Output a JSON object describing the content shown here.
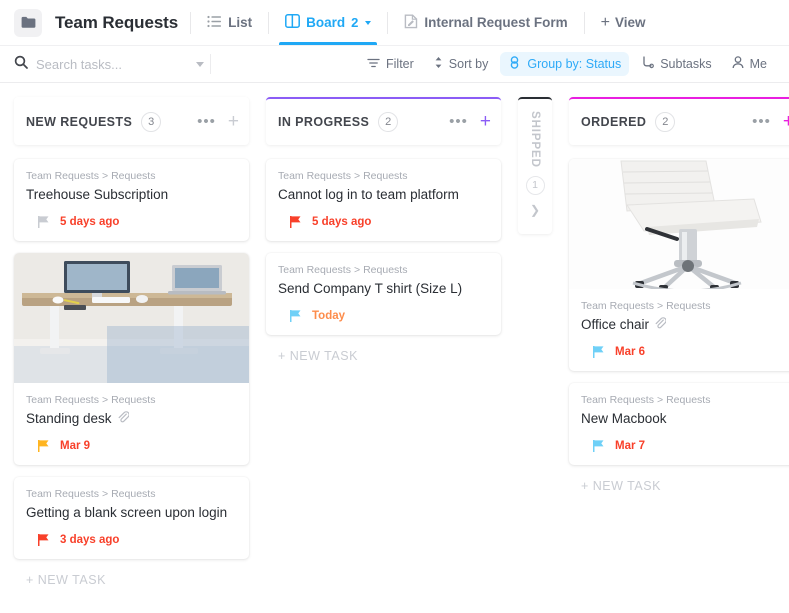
{
  "header": {
    "folder_icon": "folder-icon",
    "title": "Team Requests",
    "tabs": [
      {
        "icon": "list-icon",
        "label": "List",
        "count": "",
        "active": false
      },
      {
        "icon": "board-icon",
        "label": "Board",
        "count": "2",
        "active": true
      },
      {
        "icon": "form-icon",
        "label": "Internal Request Form",
        "count": "",
        "active": false
      }
    ],
    "add_view_label": "View",
    "add_view_plus": "+"
  },
  "toolbar": {
    "search_placeholder": "Search tasks...",
    "search_value": "",
    "search_icon": "search-icon",
    "dropdown_icon": "chevron-down-icon",
    "items": [
      {
        "icon": "filter-icon",
        "label": "Filter",
        "active": false
      },
      {
        "icon": "sort-icon",
        "label": "Sort by",
        "active": false
      },
      {
        "icon": "group-icon",
        "label": "Group by: Status",
        "active": true
      },
      {
        "icon": "subtasks-icon",
        "label": "Subtasks",
        "active": false
      },
      {
        "icon": "person-icon",
        "label": "Me",
        "active": false
      }
    ]
  },
  "accents": {
    "blue": "#1fa8f5",
    "purple": "#8b5cf6",
    "magenta": "#e91ee0",
    "dark": "#2a2e34",
    "red": "#f8402a",
    "orange": "#fd8c4b",
    "yellow": "#ffb521",
    "lightblue": "#6fd0f7",
    "gray_flag": "#c9ccd2"
  },
  "new_task_label": "+ NEW TASK",
  "columns": [
    {
      "name": "NEW REQUESTS",
      "count": "3",
      "accent": "transparent",
      "plus_color": "#c9ccd2",
      "collapsed": false,
      "cards": [
        {
          "breadcrumb_root": "Team Requests",
          "breadcrumb_sep": ">",
          "breadcrumb_leaf": "Requests",
          "title": "Treehouse Subscription",
          "attachment": false,
          "flag_color": "#c9ccd2",
          "due": "5 days ago",
          "due_color": "#f8402a",
          "image": null
        },
        {
          "breadcrumb_root": "Team Requests",
          "breadcrumb_sep": ">",
          "breadcrumb_leaf": "Requests",
          "title": "Standing desk",
          "attachment": true,
          "flag_color": "#ffb521",
          "due": "Mar 9",
          "due_color": "#f8402a",
          "image": "standing-desk-photo"
        },
        {
          "breadcrumb_root": "Team Requests",
          "breadcrumb_sep": ">",
          "breadcrumb_leaf": "Requests",
          "title": "Getting a blank screen upon login",
          "attachment": false,
          "flag_color": "#f8402a",
          "due": "3 days ago",
          "due_color": "#f8402a",
          "image": null
        }
      ]
    },
    {
      "name": "IN PROGRESS",
      "count": "2",
      "accent": "#8b5cf6",
      "plus_color": "#8b5cf6",
      "collapsed": false,
      "cards": [
        {
          "breadcrumb_root": "Team Requests",
          "breadcrumb_sep": ">",
          "breadcrumb_leaf": "Requests",
          "title": "Cannot log in to team platform",
          "attachment": false,
          "flag_color": "#f8402a",
          "due": "5 days ago",
          "due_color": "#f8402a",
          "image": null
        },
        {
          "breadcrumb_root": "Team Requests",
          "breadcrumb_sep": ">",
          "breadcrumb_leaf": "Requests",
          "title": "Send Company T shirt (Size L)",
          "attachment": false,
          "flag_color": "#6fd0f7",
          "due": "Today",
          "due_color": "#fd8c4b",
          "image": null
        }
      ]
    },
    {
      "name": "SHIPPED",
      "count": "1",
      "accent": "#2a2e34",
      "plus_color": "#c9ccd2",
      "collapsed": true,
      "expand_icon": "chevron-right-icon",
      "cards": []
    },
    {
      "name": "ORDERED",
      "count": "2",
      "accent": "#e91ee0",
      "plus_color": "#e91ee0",
      "collapsed": false,
      "cards": [
        {
          "breadcrumb_root": "Team Requests",
          "breadcrumb_sep": ">",
          "breadcrumb_leaf": "Requests",
          "title": "Office chair",
          "attachment": true,
          "flag_color": "#6fd0f7",
          "due": "Mar 6",
          "due_color": "#f8402a",
          "image": "office-chair-photo"
        },
        {
          "breadcrumb_root": "Team Requests",
          "breadcrumb_sep": ">",
          "breadcrumb_leaf": "Requests",
          "title": "New Macbook",
          "attachment": false,
          "flag_color": "#6fd0f7",
          "due": "Mar 7",
          "due_color": "#f8402a",
          "image": null
        }
      ]
    }
  ]
}
